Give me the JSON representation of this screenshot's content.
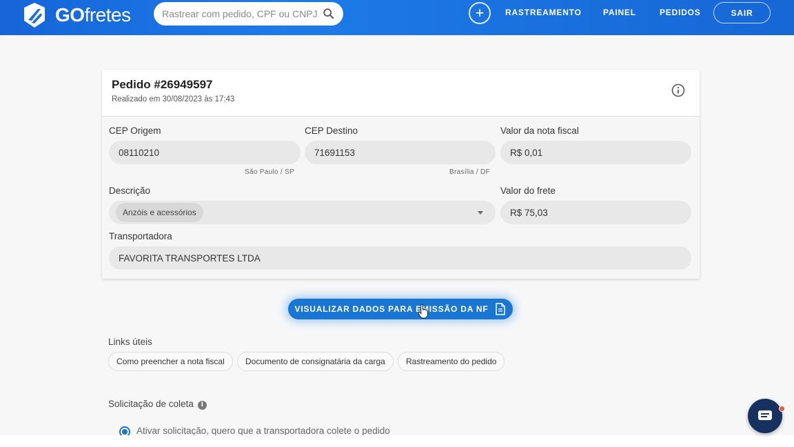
{
  "header": {
    "logo_bold": "GO",
    "logo_thin": "fretes",
    "search_placeholder": "Rastrear com pedido, CPF ou CNPJ",
    "add_label": "+",
    "nav": [
      "RASTREAMENTO",
      "PAINEL",
      "PEDIDOS"
    ],
    "logout_label": "SAIR"
  },
  "order": {
    "title": "Pedido #26949597",
    "date": "Realizado em 30/08/2023 às 17:43",
    "fields": {
      "origin_label": "CEP Origem",
      "origin_value": "08110210",
      "origin_hint": "São Paulo / SP",
      "dest_label": "CEP Destino",
      "dest_value": "71691153",
      "dest_hint": "Brasília / DF",
      "invoice_label": "Valor da nota fiscal",
      "invoice_value": "R$ 0,01",
      "desc_label": "Descrição",
      "desc_value": "Anzóis e acessórios",
      "freight_label": "Valor do frete",
      "freight_value": "R$ 75,03",
      "carrier_label": "Transportadora",
      "carrier_value": "FAVORITA TRANSPORTES LTDA"
    }
  },
  "primary_button": "VISUALIZAR DADOS PARA EMISSÃO DA NF",
  "links": {
    "label": "Links úteis",
    "items": [
      "Como preencher a nota fiscal",
      "Documento de consignatária da carga",
      "Rastreamento do pedido"
    ]
  },
  "pickup": {
    "label": "Solicitação de coleta",
    "info_glyph": "i",
    "option": "Ativar solicitação, quero que a transportadora colete o pedido"
  },
  "colors": {
    "header_blue": "#1a73e0",
    "primary": "#1976d2",
    "chat": "#16305f",
    "notification": "#ef5a3c"
  }
}
